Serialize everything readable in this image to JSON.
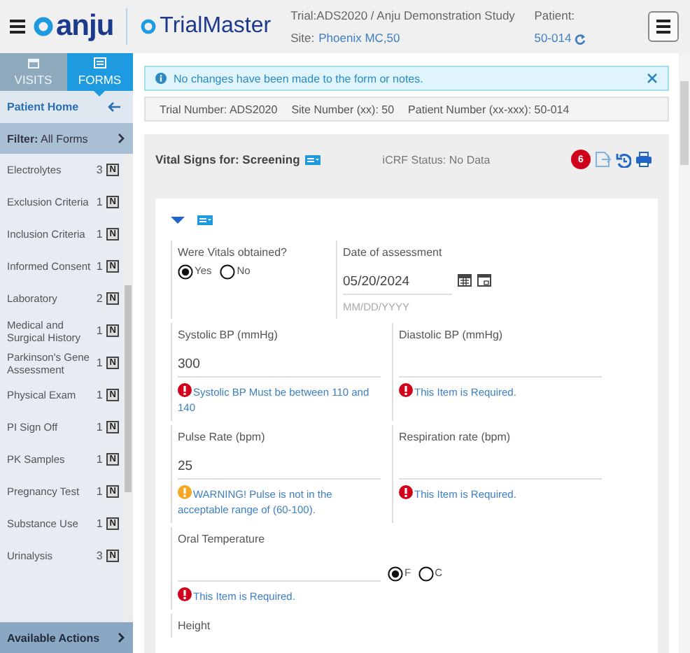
{
  "header": {
    "logo": "anju",
    "product": "TrialMaster",
    "trial": "Trial:ADS2020 / Anju Demonstration Study",
    "site_label": "Site:",
    "site": "Phoenix MC,50",
    "patient_label": "Patient:",
    "patient": "50-014"
  },
  "sidebar": {
    "tabs": [
      {
        "label": "VISITS",
        "selected": false
      },
      {
        "label": "FORMS",
        "selected": true
      }
    ],
    "patient_home": "Patient Home",
    "filter": {
      "label": "Filter:",
      "value": "All Forms"
    },
    "forms": [
      {
        "name": "Electrolytes",
        "count": "3",
        "status": "N"
      },
      {
        "name": "Exclusion Criteria",
        "count": "1",
        "status": "N"
      },
      {
        "name": "Inclusion Criteria",
        "count": "1",
        "status": "N"
      },
      {
        "name": "Informed Consent",
        "count": "1",
        "status": "N"
      },
      {
        "name": "Laboratory",
        "count": "2",
        "status": "N"
      },
      {
        "name": "Medical and Surgical History",
        "count": "1",
        "status": "N"
      },
      {
        "name": "Parkinson's Gene Assessment",
        "count": "1",
        "status": "N"
      },
      {
        "name": "Physical Exam",
        "count": "1",
        "status": "N"
      },
      {
        "name": "PI Sign Off",
        "count": "1",
        "status": "N"
      },
      {
        "name": "PK Samples",
        "count": "1",
        "status": "N"
      },
      {
        "name": "Pregnancy Test",
        "count": "1",
        "status": "N"
      },
      {
        "name": "Substance Use",
        "count": "1",
        "status": "N"
      },
      {
        "name": "Urinalysis",
        "count": "3",
        "status": "N"
      }
    ],
    "footer": "Available Actions"
  },
  "alert": "No changes have been made to the form or notes.",
  "info": [
    "Trial Number: ADS2020",
    "Site Number (xx): 50",
    "Patient Number (xx-xxx): 50-014"
  ],
  "form": {
    "title": "Vital Signs for: Screening",
    "status": "iCRF Status: No Data",
    "badge": "6",
    "rows": [
      [
        {
          "kind": "radio",
          "label": "Were Vitals obtained?",
          "options": [
            {
              "label": "Yes",
              "selected": true
            },
            {
              "label": "No",
              "selected": false
            }
          ]
        },
        {
          "kind": "date",
          "label": "Date of assessment",
          "value": "05/20/2024",
          "hint": "MM/DD/YYYY"
        }
      ],
      [
        {
          "kind": "text",
          "label": "Systolic BP (mmHg)",
          "value": "300",
          "message": {
            "kind": "error",
            "text": "Systolic BP Must be between 110 and 140"
          }
        },
        {
          "kind": "text",
          "label": "Diastolic BP (mmHg)",
          "message": {
            "kind": "error",
            "text": "This Item is Required."
          }
        }
      ],
      [
        {
          "kind": "text",
          "label": "Pulse Rate (bpm)",
          "value": "25",
          "message": {
            "kind": "warning",
            "text": "WARNING! Pulse is not in the acceptable range of (60-100)."
          }
        },
        {
          "kind": "text",
          "label": "Respiration rate (bpm)",
          "message": {
            "kind": "error",
            "text": "This Item is Required."
          }
        }
      ],
      [
        {
          "kind": "units",
          "label": "Oral Temperature",
          "options": [
            {
              "label": "F",
              "selected": true
            },
            {
              "label": "C",
              "selected": false
            }
          ],
          "message": {
            "kind": "error",
            "text": "This Item is Required."
          }
        }
      ],
      [
        {
          "kind": "label",
          "label": "Height"
        }
      ]
    ]
  }
}
